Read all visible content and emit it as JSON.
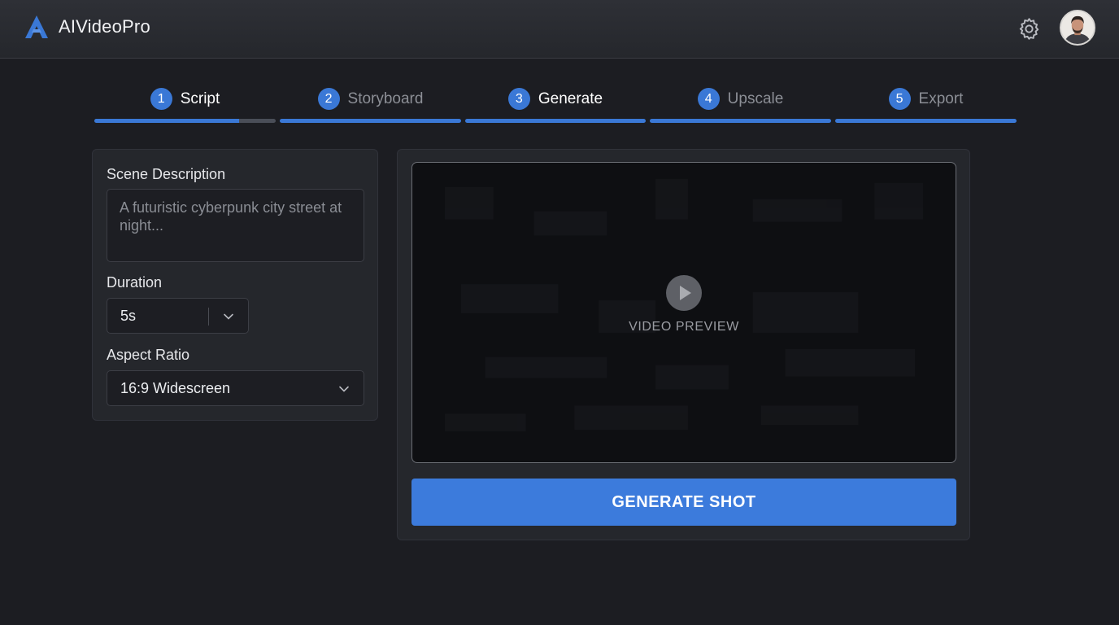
{
  "app": {
    "name": "AIVideoPro",
    "accent_color": "#3a78d6"
  },
  "header": {
    "settings_icon": "gear-icon",
    "avatar_icon": "user-avatar"
  },
  "steps": [
    {
      "number": "1",
      "label": "Script",
      "active": true,
      "progress": 0.8
    },
    {
      "number": "2",
      "label": "Storyboard",
      "active": false,
      "progress": 1
    },
    {
      "number": "3",
      "label": "Generate",
      "active": true,
      "progress": 1
    },
    {
      "number": "4",
      "label": "Upscale",
      "active": false,
      "progress": 1
    },
    {
      "number": "5",
      "label": "Export",
      "active": false,
      "progress": 1
    }
  ],
  "form": {
    "scene_label": "Scene Description",
    "scene_placeholder": "A futuristic cyberpunk city street at night...",
    "duration_label": "Duration",
    "duration_value": "5s",
    "aspect_label": "Aspect Ratio",
    "aspect_value": "16:9 Widescreen"
  },
  "preview": {
    "label": "VIDEO PREVIEW",
    "play_icon": "play-icon"
  },
  "actions": {
    "generate_label": "GENERATE SHOT"
  }
}
